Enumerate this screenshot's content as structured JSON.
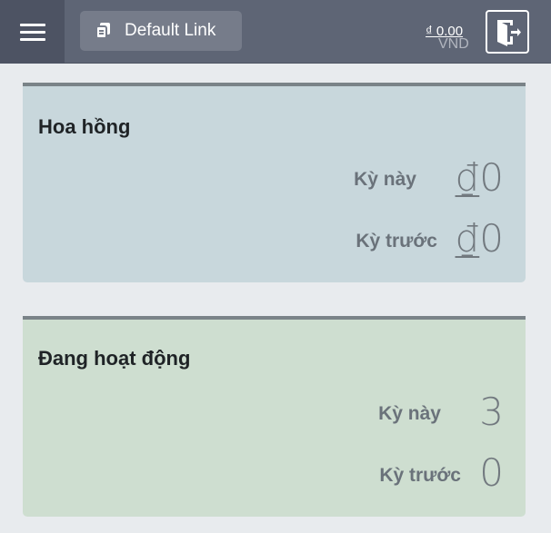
{
  "topbar": {
    "default_link_label": "Default Link",
    "balance_amount": "₫ 0.00",
    "balance_currency": "VND"
  },
  "cards": {
    "commission": {
      "title": "Hoa hồng",
      "this_period_label": "Kỳ này",
      "this_period_symbol": "₫",
      "this_period_value": "0",
      "last_period_label": "Kỳ trước",
      "last_period_symbol": "₫",
      "last_period_value": "0"
    },
    "active": {
      "title": "Đang hoạt động",
      "this_period_label": "Kỳ này",
      "this_period_value": "3",
      "last_period_label": "Kỳ trước",
      "last_period_value": "0"
    }
  },
  "icons": {
    "menu": "hamburger-icon",
    "link": "copy-icon",
    "logout": "exit-door-icon"
  }
}
